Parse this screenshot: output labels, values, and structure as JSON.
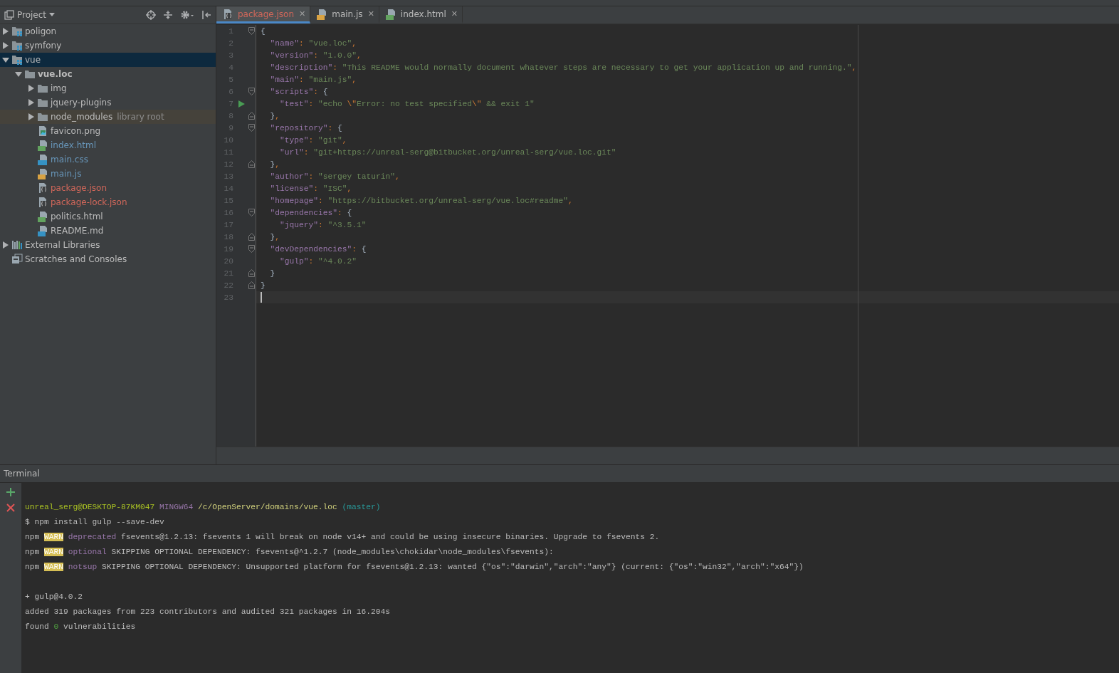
{
  "project_panel": {
    "title": "Project",
    "tools": [
      {
        "kind": "locate"
      },
      {
        "kind": "collapse"
      },
      {
        "kind": "settings"
      },
      {
        "kind": "hide"
      }
    ],
    "tree": [
      {
        "label": "poligon",
        "kind": "module",
        "expanded": false,
        "selected": false,
        "color": "#bbbbbb"
      },
      {
        "label": "symfony",
        "kind": "module",
        "expanded": false,
        "selected": false,
        "color": "#bbbbbb"
      },
      {
        "label": "vue",
        "kind": "module",
        "expanded": true,
        "selected": true,
        "color": "#bbbbbb",
        "children": [
          {
            "label": "vue.loc",
            "kind": "folder",
            "expanded": true,
            "selected": false,
            "bold": true,
            "color": "#bbbbbb",
            "children": [
              {
                "label": "img",
                "kind": "folder",
                "expanded": false,
                "selected": false,
                "color": "#bbbbbb"
              },
              {
                "label": "jquery-plugins",
                "kind": "folder",
                "expanded": false,
                "selected": false,
                "color": "#bbbbbb"
              },
              {
                "label": "node_modules",
                "kind": "folder",
                "expanded": false,
                "selected": false,
                "library": true,
                "note": "library root",
                "color": "#bbbbbb"
              },
              {
                "label": "favicon.png",
                "kind": "image",
                "selected": false,
                "color": "#bbbbbb"
              },
              {
                "label": "index.html",
                "kind": "html",
                "selected": false,
                "color": "#6897bb"
              },
              {
                "label": "main.css",
                "kind": "css",
                "selected": false,
                "color": "#6897bb"
              },
              {
                "label": "main.js",
                "kind": "js",
                "selected": false,
                "color": "#6897bb"
              },
              {
                "label": "package.json",
                "kind": "json",
                "selected": false,
                "color": "#d1675a"
              },
              {
                "label": "package-lock.json",
                "kind": "json",
                "selected": false,
                "color": "#d1675a"
              },
              {
                "label": "politics.html",
                "kind": "html",
                "selected": false,
                "color": "#bbbbbb"
              },
              {
                "label": "README.md",
                "kind": "md",
                "selected": false,
                "color": "#bbbbbb"
              }
            ]
          }
        ]
      },
      {
        "label": "External Libraries",
        "kind": "libraries",
        "expanded": false,
        "selected": false,
        "color": "#bbbbbb"
      },
      {
        "label": "Scratches and Consoles",
        "kind": "scratches",
        "selected": false,
        "color": "#bbbbbb"
      }
    ]
  },
  "tabs": [
    {
      "label": "package.json",
      "kind": "json",
      "selected": true,
      "color": "#d1675a",
      "close": "✕"
    },
    {
      "label": "main.js",
      "kind": "js",
      "selected": false,
      "color": "#bbbbbb",
      "close": "✕"
    },
    {
      "label": "index.html",
      "kind": "html",
      "selected": false,
      "color": "#bbbbbb",
      "close": "✕"
    }
  ],
  "editor": {
    "lines": [
      {
        "num": "1",
        "fold_start": true,
        "fold_end": false,
        "run": false,
        "current": false,
        "t": [
          {
            "kind": "brace",
            "text": "{"
          }
        ]
      },
      {
        "num": "2",
        "fold_start": false,
        "fold_end": false,
        "run": false,
        "current": false,
        "t": [
          {
            "kind": "key",
            "text": "  \"name\""
          },
          {
            "kind": "op",
            "text": ": "
          },
          {
            "kind": "str",
            "text": "\"vue.loc\""
          },
          {
            "kind": "op",
            "text": ","
          }
        ]
      },
      {
        "num": "3",
        "fold_start": false,
        "fold_end": false,
        "run": false,
        "current": false,
        "t": [
          {
            "kind": "key",
            "text": "  \"version\""
          },
          {
            "kind": "op",
            "text": ": "
          },
          {
            "kind": "str",
            "text": "\"1.0.0\""
          },
          {
            "kind": "op",
            "text": ","
          }
        ]
      },
      {
        "num": "4",
        "fold_start": false,
        "fold_end": false,
        "run": false,
        "current": false,
        "t": [
          {
            "kind": "key",
            "text": "  \"description\""
          },
          {
            "kind": "op",
            "text": ": "
          },
          {
            "kind": "str",
            "text": "\"This README would normally document whatever steps are necessary to get your application up and running.\""
          },
          {
            "kind": "op",
            "text": ","
          }
        ]
      },
      {
        "num": "5",
        "fold_start": false,
        "fold_end": false,
        "run": false,
        "current": false,
        "t": [
          {
            "kind": "key",
            "text": "  \"main\""
          },
          {
            "kind": "op",
            "text": ": "
          },
          {
            "kind": "str",
            "text": "\"main.js\""
          },
          {
            "kind": "op",
            "text": ","
          }
        ]
      },
      {
        "num": "6",
        "fold_start": true,
        "fold_end": false,
        "run": false,
        "current": false,
        "t": [
          {
            "kind": "key",
            "text": "  \"scripts\""
          },
          {
            "kind": "op",
            "text": ": "
          },
          {
            "kind": "brace",
            "text": "{"
          }
        ]
      },
      {
        "num": "7",
        "fold_start": false,
        "fold_end": false,
        "run": true,
        "current": false,
        "t": [
          {
            "kind": "key",
            "text": "    \"test\""
          },
          {
            "kind": "op",
            "text": ": "
          },
          {
            "kind": "str",
            "text": "\"echo "
          },
          {
            "kind": "esc",
            "text": "\\\""
          },
          {
            "kind": "str",
            "text": "Error: no test specified"
          },
          {
            "kind": "esc",
            "text": "\\\""
          },
          {
            "kind": "str",
            "text": " && exit 1\""
          }
        ]
      },
      {
        "num": "8",
        "fold_start": false,
        "fold_end": true,
        "run": false,
        "current": false,
        "t": [
          {
            "kind": "brace",
            "text": "  }"
          },
          {
            "kind": "op",
            "text": ","
          }
        ]
      },
      {
        "num": "9",
        "fold_start": true,
        "fold_end": false,
        "run": false,
        "current": false,
        "t": [
          {
            "kind": "key",
            "text": "  \"repository\""
          },
          {
            "kind": "op",
            "text": ": "
          },
          {
            "kind": "brace",
            "text": "{"
          }
        ]
      },
      {
        "num": "10",
        "fold_start": false,
        "fold_end": false,
        "run": false,
        "current": false,
        "t": [
          {
            "kind": "key",
            "text": "    \"type\""
          },
          {
            "kind": "op",
            "text": ": "
          },
          {
            "kind": "str",
            "text": "\"git\""
          },
          {
            "kind": "op",
            "text": ","
          }
        ]
      },
      {
        "num": "11",
        "fold_start": false,
        "fold_end": false,
        "run": false,
        "current": false,
        "t": [
          {
            "kind": "key",
            "text": "    \"url\""
          },
          {
            "kind": "op",
            "text": ": "
          },
          {
            "kind": "str",
            "text": "\"git+https://unreal-serg@bitbucket.org/unreal-serg/vue.loc.git\""
          }
        ]
      },
      {
        "num": "12",
        "fold_start": false,
        "fold_end": true,
        "run": false,
        "current": false,
        "t": [
          {
            "kind": "brace",
            "text": "  }"
          },
          {
            "kind": "op",
            "text": ","
          }
        ]
      },
      {
        "num": "13",
        "fold_start": false,
        "fold_end": false,
        "run": false,
        "current": false,
        "t": [
          {
            "kind": "key",
            "text": "  \"author\""
          },
          {
            "kind": "op",
            "text": ": "
          },
          {
            "kind": "str",
            "text": "\"sergey taturin\""
          },
          {
            "kind": "op",
            "text": ","
          }
        ]
      },
      {
        "num": "14",
        "fold_start": false,
        "fold_end": false,
        "run": false,
        "current": false,
        "t": [
          {
            "kind": "key",
            "text": "  \"license\""
          },
          {
            "kind": "op",
            "text": ": "
          },
          {
            "kind": "str",
            "text": "\"ISC\""
          },
          {
            "kind": "op",
            "text": ","
          }
        ]
      },
      {
        "num": "15",
        "fold_start": false,
        "fold_end": false,
        "run": false,
        "current": false,
        "t": [
          {
            "kind": "key",
            "text": "  \"homepage\""
          },
          {
            "kind": "op",
            "text": ": "
          },
          {
            "kind": "str",
            "text": "\"https://bitbucket.org/unreal-serg/vue.loc#readme\""
          },
          {
            "kind": "op",
            "text": ","
          }
        ]
      },
      {
        "num": "16",
        "fold_start": true,
        "fold_end": false,
        "run": false,
        "current": false,
        "t": [
          {
            "kind": "key",
            "text": "  \"dependencies\""
          },
          {
            "kind": "op",
            "text": ": "
          },
          {
            "kind": "brace",
            "text": "{"
          }
        ]
      },
      {
        "num": "17",
        "fold_start": false,
        "fold_end": false,
        "run": false,
        "current": false,
        "t": [
          {
            "kind": "key",
            "text": "    \"jquery\""
          },
          {
            "kind": "op",
            "text": ": "
          },
          {
            "kind": "str",
            "text": "\"^3.5.1\""
          }
        ]
      },
      {
        "num": "18",
        "fold_start": false,
        "fold_end": true,
        "run": false,
        "current": false,
        "t": [
          {
            "kind": "brace",
            "text": "  }"
          },
          {
            "kind": "op",
            "text": ","
          }
        ]
      },
      {
        "num": "19",
        "fold_start": true,
        "fold_end": false,
        "run": false,
        "current": false,
        "t": [
          {
            "kind": "key",
            "text": "  \"devDependencies\""
          },
          {
            "kind": "op",
            "text": ": "
          },
          {
            "kind": "brace",
            "text": "{"
          }
        ]
      },
      {
        "num": "20",
        "fold_start": false,
        "fold_end": false,
        "run": false,
        "current": false,
        "t": [
          {
            "kind": "key",
            "text": "    \"gulp\""
          },
          {
            "kind": "op",
            "text": ": "
          },
          {
            "kind": "str",
            "text": "\"^4.0.2\""
          }
        ]
      },
      {
        "num": "21",
        "fold_start": false,
        "fold_end": true,
        "run": false,
        "current": false,
        "t": [
          {
            "kind": "brace",
            "text": "  }"
          }
        ]
      },
      {
        "num": "22",
        "fold_start": false,
        "fold_end": true,
        "run": false,
        "current": false,
        "t": [
          {
            "kind": "brace",
            "text": "}"
          }
        ]
      },
      {
        "num": "23",
        "fold_start": false,
        "fold_end": false,
        "run": false,
        "current": true
      }
    ]
  },
  "terminal": {
    "title": "Terminal",
    "tools": [
      {
        "kind": "add"
      },
      {
        "kind": "close"
      }
    ],
    "lines": [
      {
        "blank_before": true,
        "segs": [
          {
            "kind": "user",
            "text": "unreal_serg@DESKTOP-87KM047"
          },
          {
            "kind": "host",
            "text": " MINGW64"
          },
          {
            "kind": "path",
            "text": " /c/OpenServer/domains/vue.loc"
          },
          {
            "kind": "branch",
            "text": " (master)"
          }
        ]
      },
      {
        "blank_before": false,
        "segs": [
          {
            "kind": "plain",
            "text": "$ npm install gulp --save-dev"
          }
        ]
      },
      {
        "blank_before": false,
        "segs": [
          {
            "kind": "plain",
            "text": "npm "
          },
          {
            "kind": "warn",
            "text": "WARN"
          },
          {
            "kind": "tag",
            "text": " deprecated"
          },
          {
            "kind": "plain",
            "text": " fsevents@1.2.13: fsevents 1 will break on node v14+ and could be using insecure binaries. Upgrade to fsevents 2."
          }
        ]
      },
      {
        "blank_before": false,
        "segs": [
          {
            "kind": "plain",
            "text": "npm "
          },
          {
            "kind": "warn",
            "text": "WARN"
          },
          {
            "kind": "tag",
            "text": " optional"
          },
          {
            "kind": "plain",
            "text": " SKIPPING OPTIONAL DEPENDENCY: fsevents@^1.2.7 (node_modules\\chokidar\\node_modules\\fsevents):"
          }
        ]
      },
      {
        "blank_before": false,
        "segs": [
          {
            "kind": "plain",
            "text": "npm "
          },
          {
            "kind": "warn",
            "text": "WARN"
          },
          {
            "kind": "tag",
            "text": " notsup"
          },
          {
            "kind": "plain",
            "text": " SKIPPING OPTIONAL DEPENDENCY: Unsupported platform for fsevents@1.2.13: wanted {\"os\":\"darwin\",\"arch\":\"any\"} (current: {\"os\":\"win32\",\"arch\":\"x64\"})"
          }
        ]
      },
      {
        "blank_before": true,
        "segs": [
          {
            "kind": "plain",
            "text": "+ gulp@4.0.2"
          }
        ]
      },
      {
        "blank_before": false,
        "segs": [
          {
            "kind": "plain",
            "text": "added 319 packages from 223 contributors and audited 321 packages in 16.204s"
          }
        ]
      },
      {
        "blank_before": false,
        "segs": [
          {
            "kind": "plain",
            "text": "found "
          },
          {
            "kind": "zero",
            "text": "0"
          },
          {
            "kind": "plain",
            "text": " vulnerabilities"
          }
        ]
      }
    ]
  }
}
